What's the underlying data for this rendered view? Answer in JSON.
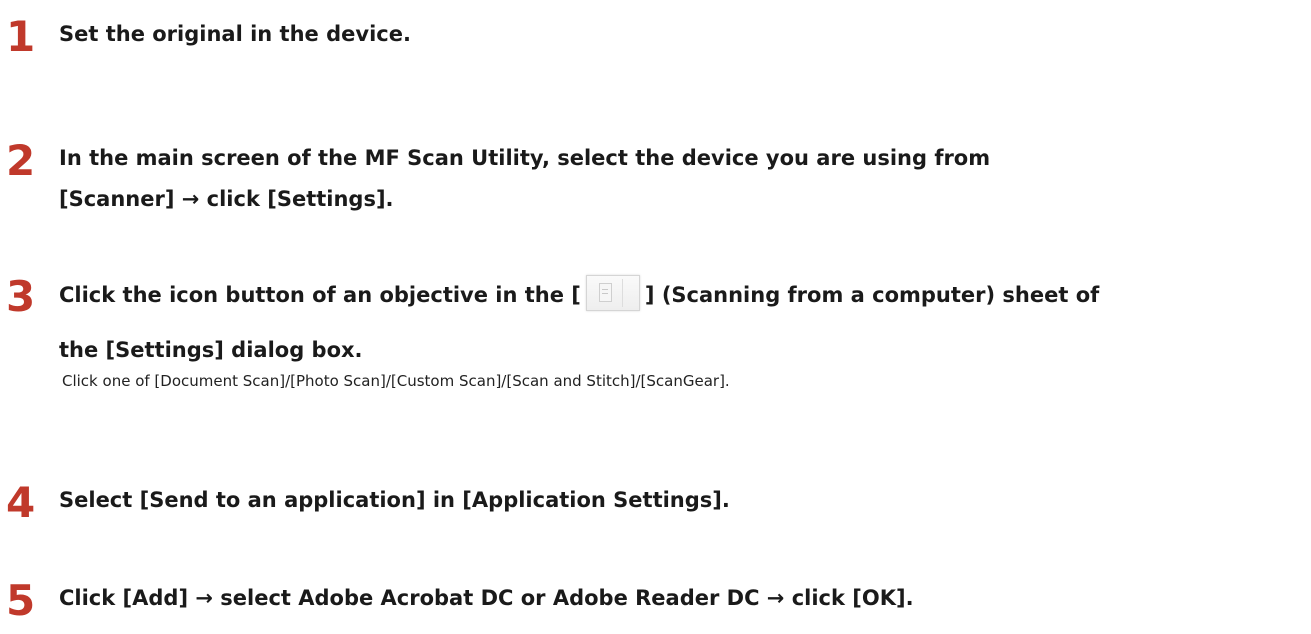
{
  "steps": [
    {
      "number": "1",
      "title": "Set the original in the device."
    },
    {
      "number": "2",
      "title_line1": "In the main screen of the MF Scan Utility, select the device you are using from",
      "title_line2": "[Scanner] → click [Settings]."
    },
    {
      "number": "3",
      "title_before_icon": "Click the icon button of an objective in the [",
      "title_after_icon": "] (Scanning from a computer) sheet of",
      "title_line2": "the [Settings] dialog box.",
      "note": "Click one of [Document Scan]/[Photo Scan]/[Custom Scan]/[Scan and Stitch]/[ScanGear].",
      "icon": "scan-from-computer-icon"
    },
    {
      "number": "4",
      "title": "Select [Send to an application] in [Application Settings]."
    },
    {
      "number": "5",
      "title": "Click [Add] → select Adobe Acrobat DC or Adobe Reader DC → click [OK]."
    }
  ],
  "colors": {
    "step_number": "#c0392b",
    "text": "#1a1a1a"
  }
}
